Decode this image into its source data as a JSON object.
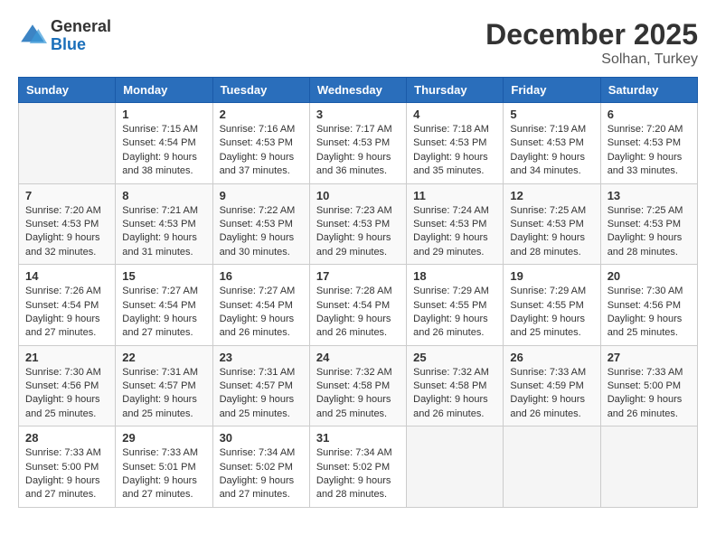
{
  "logo": {
    "general": "General",
    "blue": "Blue"
  },
  "title": {
    "month_year": "December 2025",
    "location": "Solhan, Turkey"
  },
  "weekdays": [
    "Sunday",
    "Monday",
    "Tuesday",
    "Wednesday",
    "Thursday",
    "Friday",
    "Saturday"
  ],
  "weeks": [
    [
      {
        "day": "",
        "sunrise": "",
        "sunset": "",
        "daylight": ""
      },
      {
        "day": "1",
        "sunrise": "Sunrise: 7:15 AM",
        "sunset": "Sunset: 4:54 PM",
        "daylight": "Daylight: 9 hours and 38 minutes."
      },
      {
        "day": "2",
        "sunrise": "Sunrise: 7:16 AM",
        "sunset": "Sunset: 4:53 PM",
        "daylight": "Daylight: 9 hours and 37 minutes."
      },
      {
        "day": "3",
        "sunrise": "Sunrise: 7:17 AM",
        "sunset": "Sunset: 4:53 PM",
        "daylight": "Daylight: 9 hours and 36 minutes."
      },
      {
        "day": "4",
        "sunrise": "Sunrise: 7:18 AM",
        "sunset": "Sunset: 4:53 PM",
        "daylight": "Daylight: 9 hours and 35 minutes."
      },
      {
        "day": "5",
        "sunrise": "Sunrise: 7:19 AM",
        "sunset": "Sunset: 4:53 PM",
        "daylight": "Daylight: 9 hours and 34 minutes."
      },
      {
        "day": "6",
        "sunrise": "Sunrise: 7:20 AM",
        "sunset": "Sunset: 4:53 PM",
        "daylight": "Daylight: 9 hours and 33 minutes."
      }
    ],
    [
      {
        "day": "7",
        "sunrise": "Sunrise: 7:20 AM",
        "sunset": "Sunset: 4:53 PM",
        "daylight": "Daylight: 9 hours and 32 minutes."
      },
      {
        "day": "8",
        "sunrise": "Sunrise: 7:21 AM",
        "sunset": "Sunset: 4:53 PM",
        "daylight": "Daylight: 9 hours and 31 minutes."
      },
      {
        "day": "9",
        "sunrise": "Sunrise: 7:22 AM",
        "sunset": "Sunset: 4:53 PM",
        "daylight": "Daylight: 9 hours and 30 minutes."
      },
      {
        "day": "10",
        "sunrise": "Sunrise: 7:23 AM",
        "sunset": "Sunset: 4:53 PM",
        "daylight": "Daylight: 9 hours and 29 minutes."
      },
      {
        "day": "11",
        "sunrise": "Sunrise: 7:24 AM",
        "sunset": "Sunset: 4:53 PM",
        "daylight": "Daylight: 9 hours and 29 minutes."
      },
      {
        "day": "12",
        "sunrise": "Sunrise: 7:25 AM",
        "sunset": "Sunset: 4:53 PM",
        "daylight": "Daylight: 9 hours and 28 minutes."
      },
      {
        "day": "13",
        "sunrise": "Sunrise: 7:25 AM",
        "sunset": "Sunset: 4:53 PM",
        "daylight": "Daylight: 9 hours and 28 minutes."
      }
    ],
    [
      {
        "day": "14",
        "sunrise": "Sunrise: 7:26 AM",
        "sunset": "Sunset: 4:54 PM",
        "daylight": "Daylight: 9 hours and 27 minutes."
      },
      {
        "day": "15",
        "sunrise": "Sunrise: 7:27 AM",
        "sunset": "Sunset: 4:54 PM",
        "daylight": "Daylight: 9 hours and 27 minutes."
      },
      {
        "day": "16",
        "sunrise": "Sunrise: 7:27 AM",
        "sunset": "Sunset: 4:54 PM",
        "daylight": "Daylight: 9 hours and 26 minutes."
      },
      {
        "day": "17",
        "sunrise": "Sunrise: 7:28 AM",
        "sunset": "Sunset: 4:54 PM",
        "daylight": "Daylight: 9 hours and 26 minutes."
      },
      {
        "day": "18",
        "sunrise": "Sunrise: 7:29 AM",
        "sunset": "Sunset: 4:55 PM",
        "daylight": "Daylight: 9 hours and 26 minutes."
      },
      {
        "day": "19",
        "sunrise": "Sunrise: 7:29 AM",
        "sunset": "Sunset: 4:55 PM",
        "daylight": "Daylight: 9 hours and 25 minutes."
      },
      {
        "day": "20",
        "sunrise": "Sunrise: 7:30 AM",
        "sunset": "Sunset: 4:56 PM",
        "daylight": "Daylight: 9 hours and 25 minutes."
      }
    ],
    [
      {
        "day": "21",
        "sunrise": "Sunrise: 7:30 AM",
        "sunset": "Sunset: 4:56 PM",
        "daylight": "Daylight: 9 hours and 25 minutes."
      },
      {
        "day": "22",
        "sunrise": "Sunrise: 7:31 AM",
        "sunset": "Sunset: 4:57 PM",
        "daylight": "Daylight: 9 hours and 25 minutes."
      },
      {
        "day": "23",
        "sunrise": "Sunrise: 7:31 AM",
        "sunset": "Sunset: 4:57 PM",
        "daylight": "Daylight: 9 hours and 25 minutes."
      },
      {
        "day": "24",
        "sunrise": "Sunrise: 7:32 AM",
        "sunset": "Sunset: 4:58 PM",
        "daylight": "Daylight: 9 hours and 25 minutes."
      },
      {
        "day": "25",
        "sunrise": "Sunrise: 7:32 AM",
        "sunset": "Sunset: 4:58 PM",
        "daylight": "Daylight: 9 hours and 26 minutes."
      },
      {
        "day": "26",
        "sunrise": "Sunrise: 7:33 AM",
        "sunset": "Sunset: 4:59 PM",
        "daylight": "Daylight: 9 hours and 26 minutes."
      },
      {
        "day": "27",
        "sunrise": "Sunrise: 7:33 AM",
        "sunset": "Sunset: 5:00 PM",
        "daylight": "Daylight: 9 hours and 26 minutes."
      }
    ],
    [
      {
        "day": "28",
        "sunrise": "Sunrise: 7:33 AM",
        "sunset": "Sunset: 5:00 PM",
        "daylight": "Daylight: 9 hours and 27 minutes."
      },
      {
        "day": "29",
        "sunrise": "Sunrise: 7:33 AM",
        "sunset": "Sunset: 5:01 PM",
        "daylight": "Daylight: 9 hours and 27 minutes."
      },
      {
        "day": "30",
        "sunrise": "Sunrise: 7:34 AM",
        "sunset": "Sunset: 5:02 PM",
        "daylight": "Daylight: 9 hours and 27 minutes."
      },
      {
        "day": "31",
        "sunrise": "Sunrise: 7:34 AM",
        "sunset": "Sunset: 5:02 PM",
        "daylight": "Daylight: 9 hours and 28 minutes."
      },
      {
        "day": "",
        "sunrise": "",
        "sunset": "",
        "daylight": ""
      },
      {
        "day": "",
        "sunrise": "",
        "sunset": "",
        "daylight": ""
      },
      {
        "day": "",
        "sunrise": "",
        "sunset": "",
        "daylight": ""
      }
    ]
  ]
}
